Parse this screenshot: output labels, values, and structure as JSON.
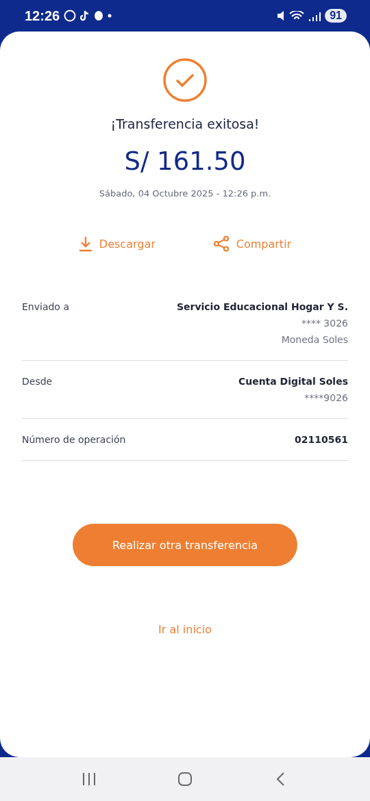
{
  "status_bar": {
    "time": "12:26",
    "battery": "91"
  },
  "result": {
    "title": "¡Transferencia exitosa!",
    "amount": "S/ 161.50",
    "date": "Sábado, 04 Octubre 2025 - 12:26 p.m."
  },
  "actions": [
    {
      "kind": "download",
      "label": "Descargar"
    },
    {
      "kind": "share",
      "label": "Compartir"
    }
  ],
  "details": [
    {
      "label": "Enviado a",
      "lines": [
        {
          "kind": "strong",
          "text": "Servicio Educacional Hogar Y S."
        },
        {
          "kind": "muted",
          "text": "**** 3026"
        },
        {
          "kind": "muted",
          "text": "Moneda Soles"
        }
      ]
    },
    {
      "label": "Desde",
      "lines": [
        {
          "kind": "strong",
          "text": "Cuenta Digital Soles"
        },
        {
          "kind": "muted",
          "text": "****9026"
        }
      ]
    },
    {
      "label": "Número de operación",
      "lines": [
        {
          "kind": "strong",
          "text": "02110561"
        }
      ]
    }
  ],
  "primary_button": "Realizar otra transferencia",
  "secondary_link": "Ir al inicio"
}
